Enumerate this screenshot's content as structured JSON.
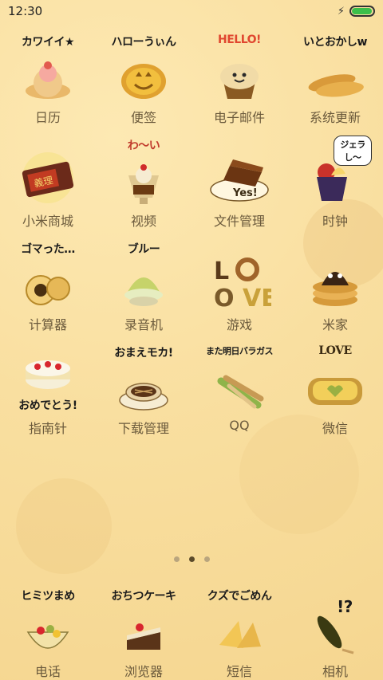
{
  "status": {
    "time": "12:30",
    "battery_level": 0.95
  },
  "apps": [
    {
      "label": "日历",
      "sticker": "カワイイ★"
    },
    {
      "label": "便签",
      "sticker": "ハローうぃん"
    },
    {
      "label": "电子邮件",
      "sticker": "HELLO!"
    },
    {
      "label": "系统更新",
      "sticker": "いとおかしw"
    },
    {
      "label": "小米商城",
      "sticker": ""
    },
    {
      "label": "视频",
      "sticker": "わ〜い"
    },
    {
      "label": "文件管理",
      "sticker": ""
    },
    {
      "label": "时钟",
      "sticker": "ジェラし〜"
    },
    {
      "label": "计算器",
      "sticker": "ゴマった…"
    },
    {
      "label": "录音机",
      "sticker": "ブルー"
    },
    {
      "label": "游戏",
      "sticker": ""
    },
    {
      "label": "米家",
      "sticker": ""
    },
    {
      "label": "指南针",
      "sticker": "おめでとう!"
    },
    {
      "label": "下载管理",
      "sticker": "おまえモカ!"
    },
    {
      "label": "QQ",
      "sticker": "また明日バラガス"
    },
    {
      "label": "微信",
      "sticker": "LOVE"
    }
  ],
  "page_indicator": {
    "count": 3,
    "active": 2
  },
  "dock": [
    {
      "label": "电话",
      "sticker": "ヒミツまめ"
    },
    {
      "label": "浏览器",
      "sticker": "おちつケーキ"
    },
    {
      "label": "短信",
      "sticker": "クズでごめん"
    },
    {
      "label": "相机",
      "sticker": "!?"
    }
  ],
  "colors": {
    "background": "#f9dfa0",
    "label_text": "#6b5a3c",
    "dot_active": "#5b4a2a",
    "dot_inactive": "#b9a57e",
    "battery": "#3bbf4a"
  }
}
